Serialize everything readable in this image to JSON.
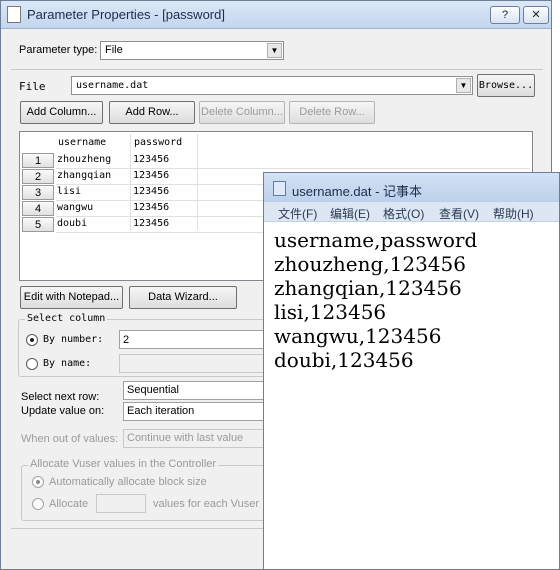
{
  "dialog": {
    "title": "Parameter Properties - [password]",
    "help_button": "?",
    "close_button": "✕",
    "parameter_type_label": "Parameter type:",
    "parameter_type_value": "File",
    "file_label": "File",
    "file_value": "username.dat",
    "browse_button": "Browse...",
    "add_column_button": "Add Column...",
    "add_row_button": "Add Row...",
    "delete_column_button": "Delete Column...",
    "delete_row_button": "Delete Row...",
    "table": {
      "columns": [
        "username",
        "password"
      ],
      "rows": [
        {
          "num": "1",
          "username": "zhouzheng",
          "password": "123456"
        },
        {
          "num": "2",
          "username": "zhangqian",
          "password": "123456"
        },
        {
          "num": "3",
          "username": "lisi",
          "password": "123456"
        },
        {
          "num": "4",
          "username": "wangwu",
          "password": "123456"
        },
        {
          "num": "5",
          "username": "doubi",
          "password": "123456"
        }
      ]
    },
    "edit_notepad_button": "Edit with Notepad...",
    "data_wizard_button": "Data Wizard...",
    "select_column": {
      "title": "Select column",
      "by_number_label": "By number:",
      "by_number_value": "2",
      "by_name_label": "By name:"
    },
    "select_next_row_label": "Select next row:",
    "select_next_row_value": "Sequential",
    "update_value_label": "Update value on:",
    "update_value_value": "Each iteration",
    "out_of_values_label": "When out of values:",
    "out_of_values_value": "Continue with last value",
    "allocate_group": {
      "title": "Allocate Vuser values in the Controller",
      "auto_label": "Automatically allocate block size",
      "allocate_label": "Allocate",
      "values_suffix": "values for each Vuser"
    }
  },
  "notepad": {
    "title": "username.dat - 记事本",
    "menu": [
      "文件(F)",
      "编辑(E)",
      "格式(O)",
      "查看(V)",
      "帮助(H)"
    ],
    "lines": [
      "username,password",
      "zhouzheng,123456",
      "zhangqian,123456",
      "lisi,123456",
      "wangwu,123456",
      "doubi,123456"
    ]
  },
  "colors": {
    "title_bar": "#c2d6ee",
    "dialog_bg": "#f0f0f0",
    "disabled_text": "#9a9a9a"
  }
}
